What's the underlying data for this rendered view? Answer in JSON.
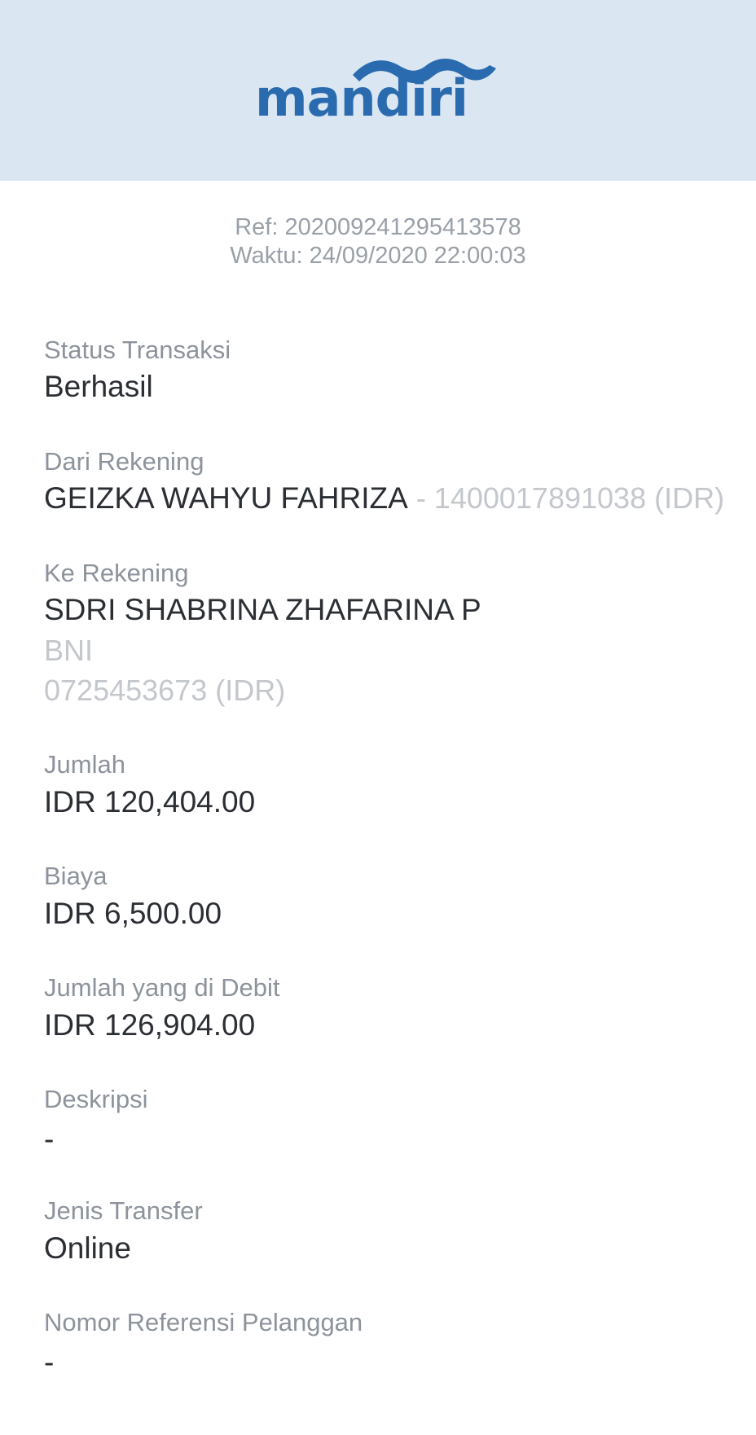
{
  "brand": {
    "logo_text": "mandiri",
    "color": "#2a6bb0",
    "header_bg": "#dae7f2"
  },
  "receipt": {
    "ref": "Ref: 202009241295413578",
    "time": "Waktu: 24/09/2020 22:00:03"
  },
  "fields": {
    "status_label": "Status Transaksi",
    "status_value": "Berhasil",
    "from_label": "Dari Rekening",
    "from_name": "GEIZKA WAHYU FAHRIZA",
    "from_account": " - 1400017891038 (IDR)",
    "to_label": "Ke Rekening",
    "to_name": "SDRI SHABRINA ZHAFARINA P",
    "to_bank": "BNI",
    "to_account": "0725453673 (IDR)",
    "amount_label": "Jumlah",
    "amount_value": "IDR 120,404.00",
    "fee_label": "Biaya",
    "fee_value": "IDR 6,500.00",
    "debit_label": "Jumlah yang di Debit",
    "debit_value": "IDR 126,904.00",
    "desc_label": "Deskripsi",
    "desc_value": "-",
    "type_label": "Jenis Transfer",
    "type_value": "Online",
    "custref_label": "Nomor Referensi Pelanggan",
    "custref_value": "-"
  }
}
